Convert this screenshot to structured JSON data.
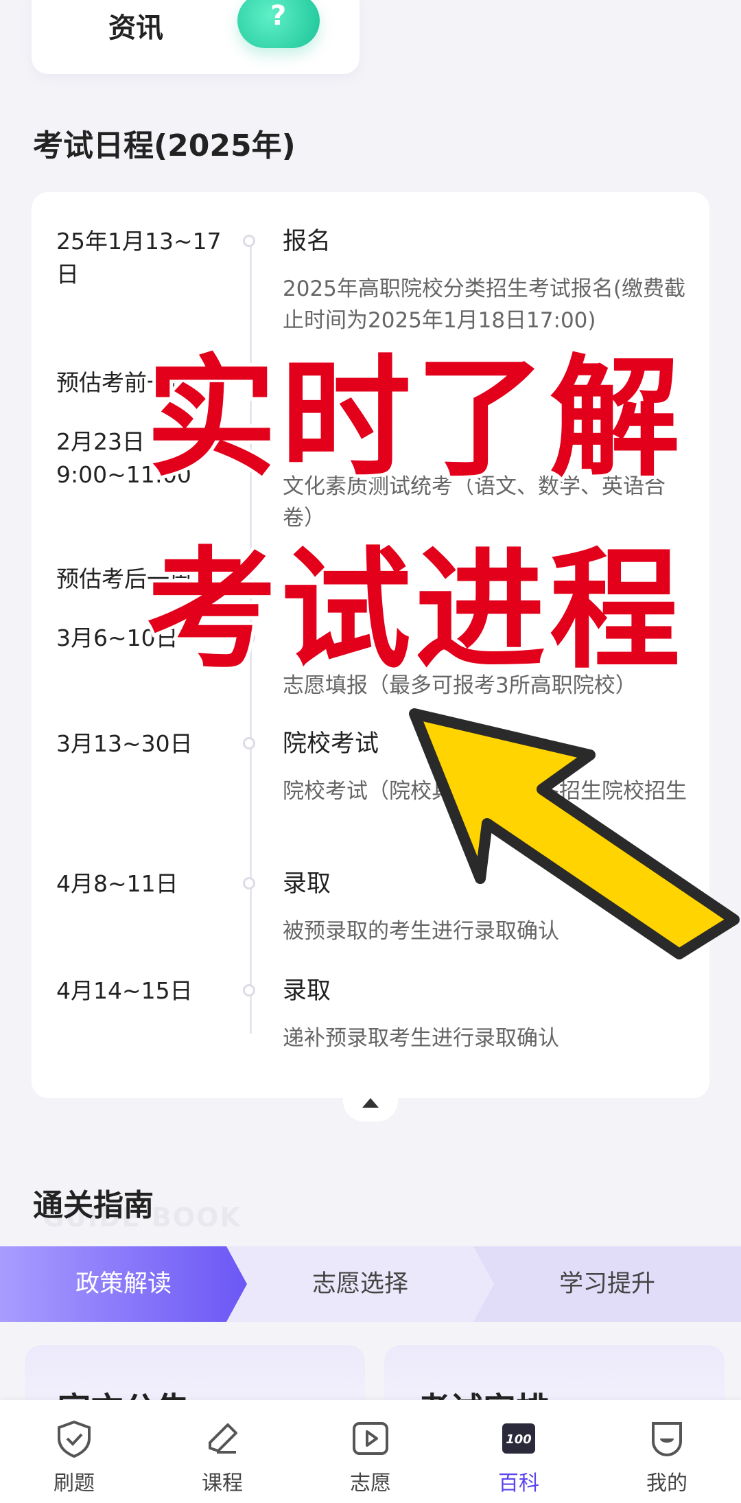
{
  "top_card": {
    "label": "资讯",
    "icon": "question-bubble-icon"
  },
  "schedule": {
    "title": "考试日程(2025年)",
    "rows": [
      {
        "date": "25年1月13~17日",
        "title": "报名",
        "desc": "2025年高职院校分类招生考试报名(缴费截止时间为2025年1月18日17:00)"
      },
      {
        "date": "预估考前一周",
        "title": "",
        "desc": ""
      },
      {
        "date": "2月23日 9:00~11:00",
        "title": "",
        "desc": "文化素质测试统考（语文、数学、英语合卷）"
      },
      {
        "date": "预估考后一周",
        "title": "",
        "desc": ""
      },
      {
        "date": "3月6~10日",
        "title": "",
        "desc": "志愿填报（最多可报考3所高职院校）"
      },
      {
        "date": "3月13~30日",
        "title": "院校考试",
        "desc": "院校考试（院校具体时间见各招生院校招生"
      },
      {
        "date": "4月8~11日",
        "title": "录取",
        "desc": "被预录取的考生进行录取确认"
      },
      {
        "date": "4月14~15日",
        "title": "录取",
        "desc": "递补预录取考生进行录取确认"
      }
    ]
  },
  "overlay": {
    "line1": "实时了解",
    "line2": "考试进程"
  },
  "guide": {
    "title": "通关指南",
    "subtitle": "GUIDE BOOK",
    "tabs": [
      "政策解读",
      "志愿选择",
      "学习提升"
    ],
    "active_tab": 0,
    "cards": [
      "官方公告",
      "考试安排"
    ]
  },
  "bottom_nav": [
    {
      "label": "刷题",
      "icon": "shield-check-icon"
    },
    {
      "label": "课程",
      "icon": "pencil-icon"
    },
    {
      "label": "志愿",
      "icon": "play-icon"
    },
    {
      "label": "百科",
      "icon": "book-100-icon",
      "active": true
    },
    {
      "label": "我的",
      "icon": "profile-icon"
    }
  ],
  "colors": {
    "accent": "#6c57f5",
    "overlay_red": "#e3001b",
    "arrow_yellow": "#ffd400"
  }
}
